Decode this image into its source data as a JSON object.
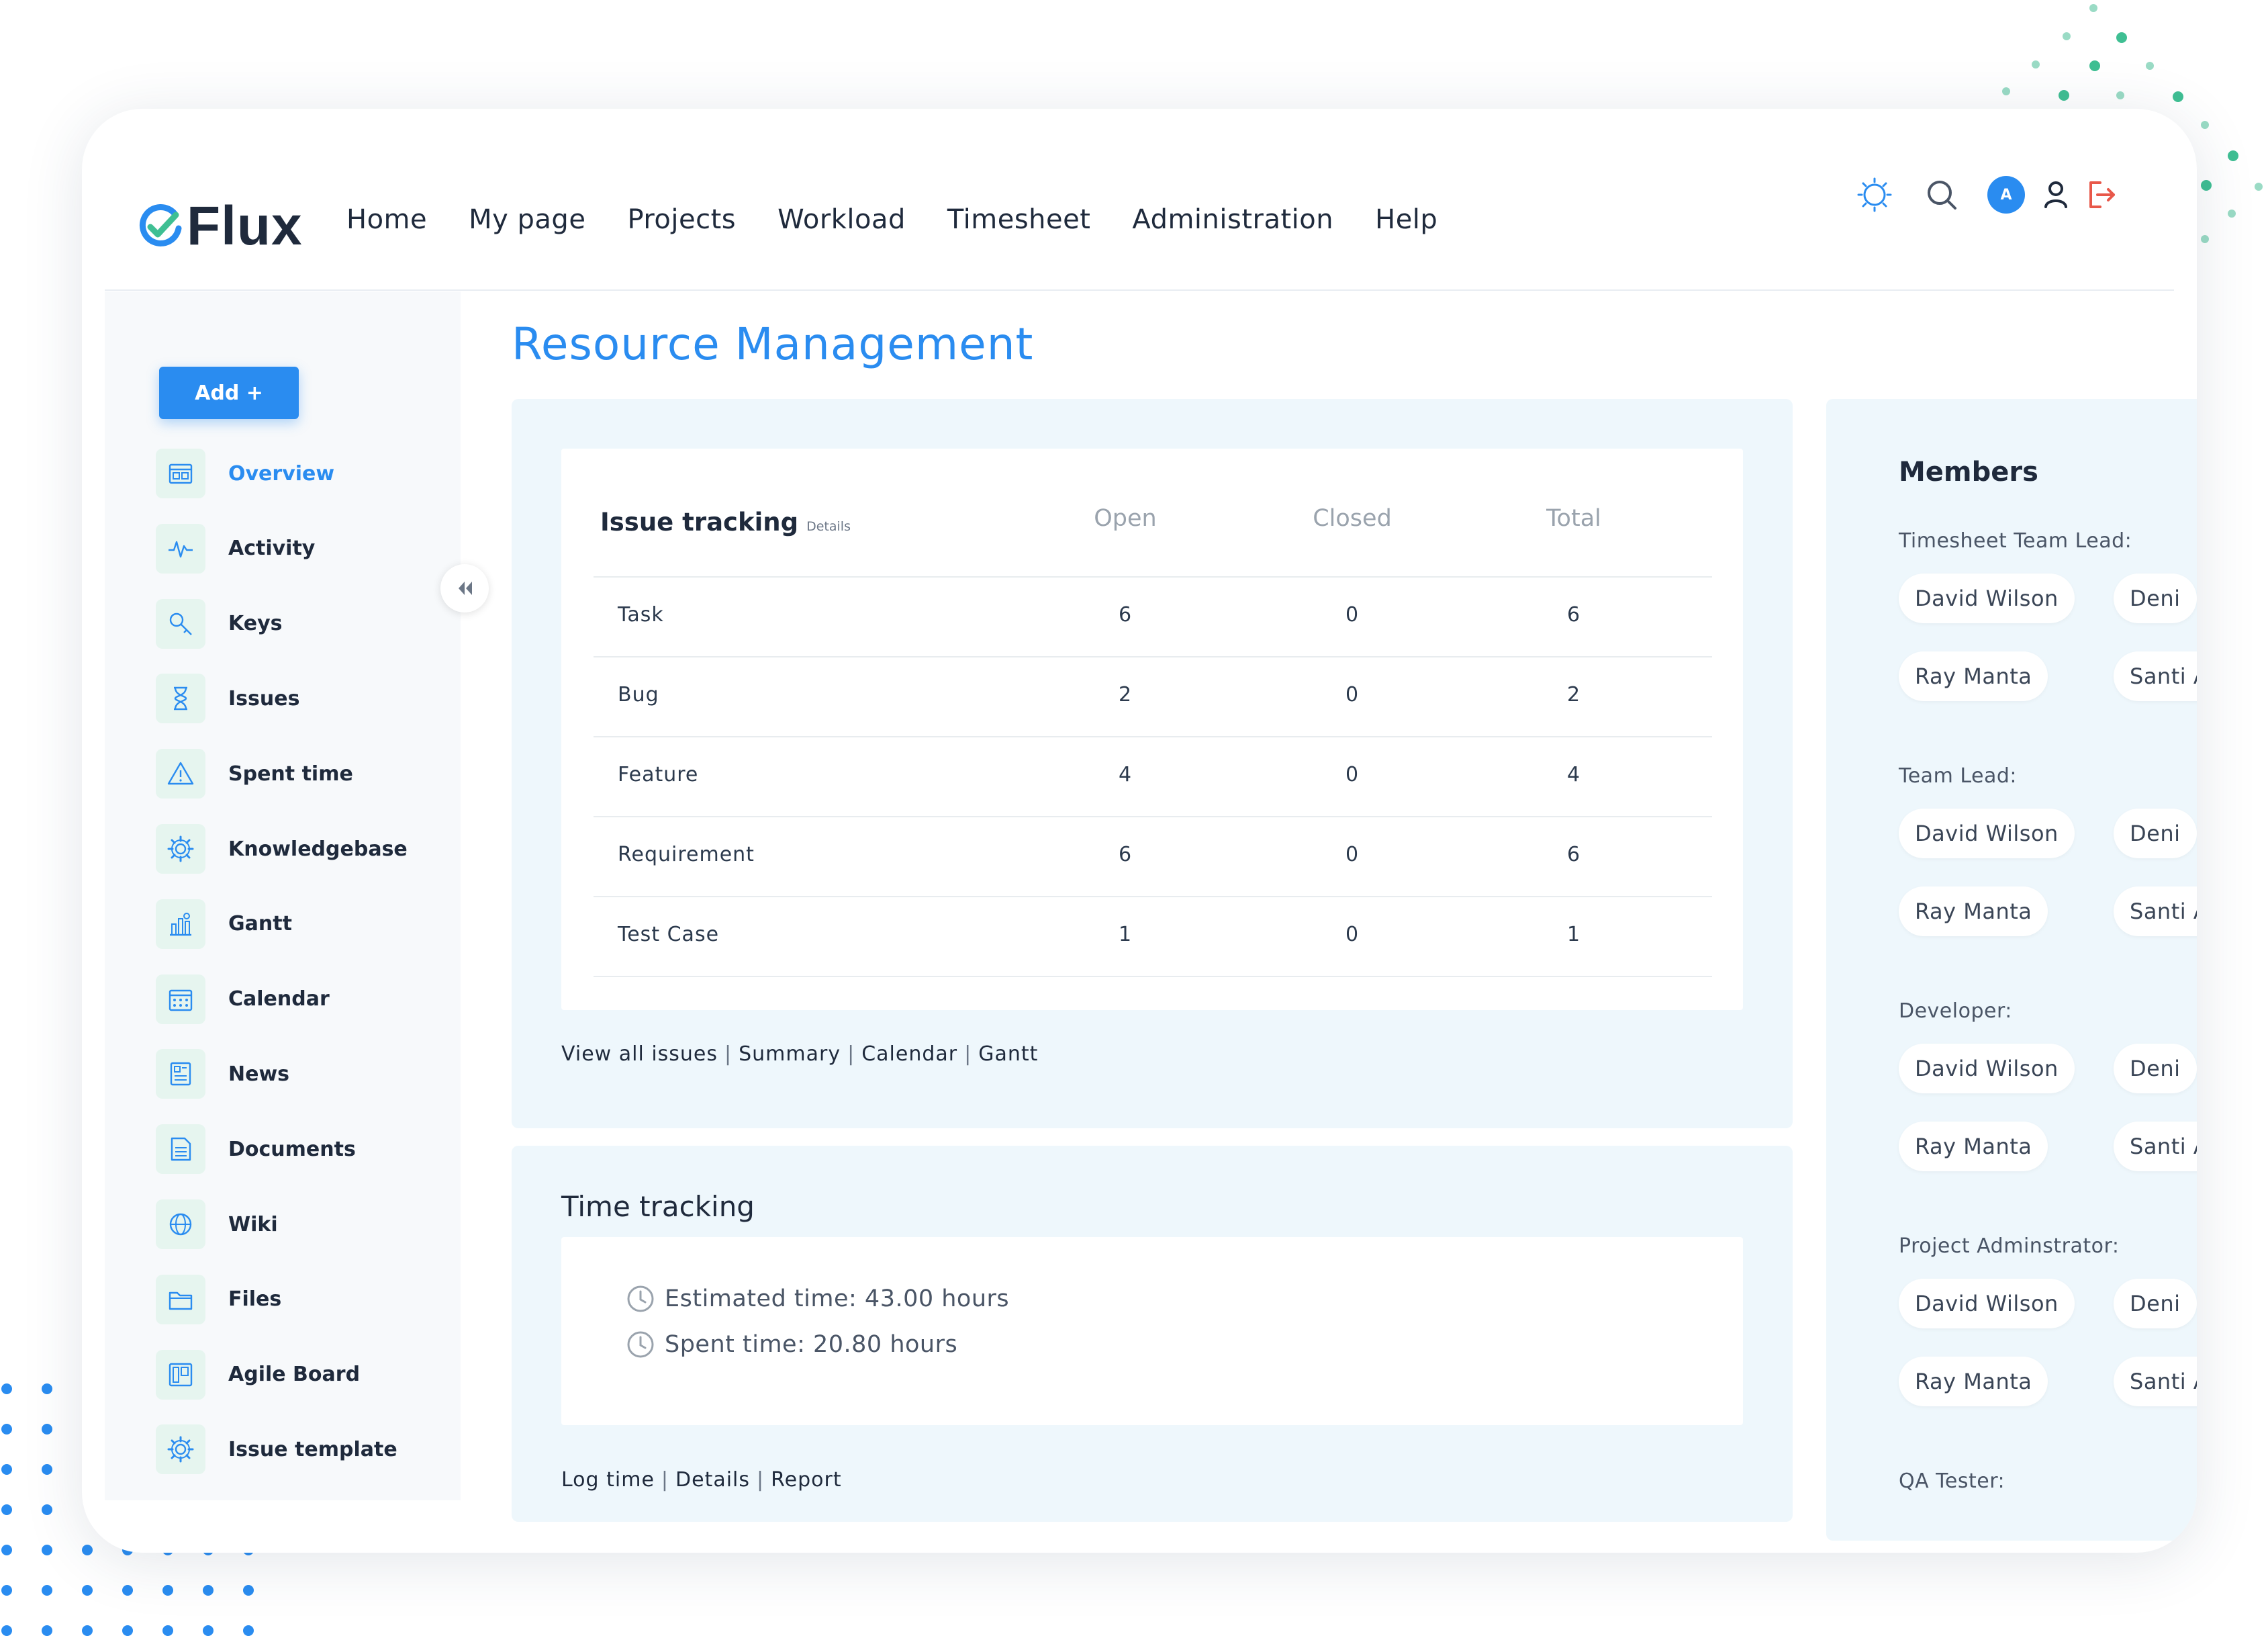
{
  "app": {
    "brand": "Flux",
    "accent": "#2a8cf0",
    "brand_green": "#3fbf93"
  },
  "nav": [
    {
      "label": "Home"
    },
    {
      "label": "My page"
    },
    {
      "label": "Projects"
    },
    {
      "label": "Workload"
    },
    {
      "label": "Timesheet"
    },
    {
      "label": "Administration"
    },
    {
      "label": "Help"
    }
  ],
  "toolbar": {
    "avatar_initial": "A",
    "icons": [
      "brightness-icon",
      "search-icon",
      "avatar",
      "user-icon",
      "logout-icon"
    ]
  },
  "sidebar": {
    "add_label": "Add +",
    "items": [
      {
        "label": "Overview",
        "icon": "overview-icon",
        "active": true
      },
      {
        "label": "Activity",
        "icon": "activity-icon"
      },
      {
        "label": "Keys",
        "icon": "keys-icon"
      },
      {
        "label": "Issues",
        "icon": "hourglass-icon"
      },
      {
        "label": "Spent time",
        "icon": "warning-icon"
      },
      {
        "label": "Knowledgebase",
        "icon": "gear-icon"
      },
      {
        "label": "Gantt",
        "icon": "gantt-icon"
      },
      {
        "label": "Calendar",
        "icon": "calendar-icon"
      },
      {
        "label": "News",
        "icon": "news-icon"
      },
      {
        "label": "Documents",
        "icon": "documents-icon"
      },
      {
        "label": "Wiki",
        "icon": "wiki-icon"
      },
      {
        "label": "Files",
        "icon": "folder-icon"
      },
      {
        "label": "Agile Board",
        "icon": "board-icon"
      },
      {
        "label": "Issue template",
        "icon": "gear-icon"
      }
    ]
  },
  "page": {
    "title": "Resource Management"
  },
  "issue_tracking": {
    "title": "Issue tracking",
    "details_link": "Details",
    "columns": [
      "Open",
      "Closed",
      "Total"
    ],
    "rows": [
      {
        "name": "Task",
        "open": "6",
        "closed": "0",
        "total": "6"
      },
      {
        "name": "Bug",
        "open": "2",
        "closed": "0",
        "total": "2"
      },
      {
        "name": "Feature",
        "open": "4",
        "closed": "0",
        "total": "4"
      },
      {
        "name": "Requirement",
        "open": "6",
        "closed": "0",
        "total": "6"
      },
      {
        "name": "Test Case",
        "open": "1",
        "closed": "0",
        "total": "1"
      }
    ],
    "links": [
      "View all issues",
      "Summary",
      "Calendar",
      "Gantt"
    ]
  },
  "time_tracking": {
    "title": "Time tracking",
    "estimated": "Estimated time: 43.00 hours",
    "spent": "Spent time: 20.80 hours",
    "links": [
      "Log time",
      "Details",
      "Report"
    ]
  },
  "members": {
    "title": "Members",
    "groups": [
      {
        "role": "Timesheet Team Lead:",
        "people": [
          "David Wilson",
          "Deni",
          "Ray Manta",
          "Santi A"
        ]
      },
      {
        "role": "Team Lead:",
        "people": [
          "David Wilson",
          "Deni",
          "Ray Manta",
          "Santi A"
        ]
      },
      {
        "role": "Developer:",
        "people": [
          "David Wilson",
          "Deni",
          "Ray Manta",
          "Santi A"
        ]
      },
      {
        "role": "Project Adminstrator:",
        "people": [
          "David Wilson",
          "Deni",
          "Ray Manta",
          "Santi A"
        ]
      },
      {
        "role": "QA Tester:",
        "people": []
      }
    ]
  }
}
